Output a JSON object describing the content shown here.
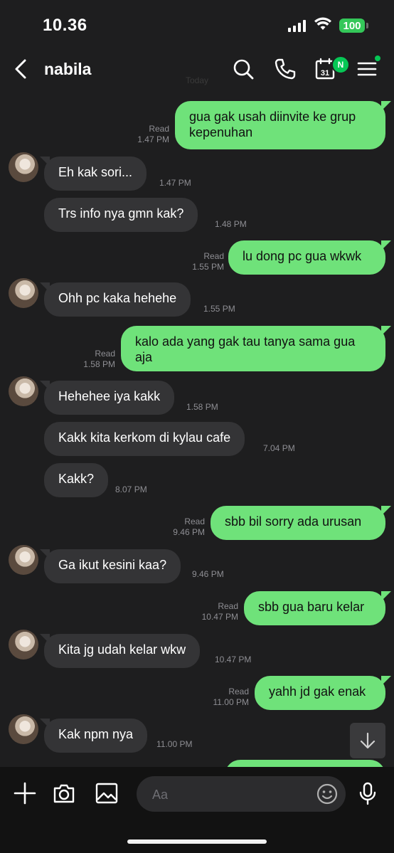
{
  "status_bar": {
    "time": "10.36",
    "battery": "100"
  },
  "header": {
    "title": "nabila",
    "calendar_day": "31",
    "badge": "N"
  },
  "divider_label": "Today",
  "messages": [
    {
      "dir": "out",
      "lines": [
        "gua gak usah diinvite ke grup",
        "kepenuhan"
      ],
      "read": "Read",
      "time": "1.47 PM"
    },
    {
      "dir": "in",
      "lines": [
        "Eh kak sori..."
      ],
      "time": "1.47 PM"
    },
    {
      "dir": "in",
      "lines": [
        "Trs info nya gmn kak?"
      ],
      "time": "1.48 PM"
    },
    {
      "dir": "out",
      "lines": [
        "lu dong pc gua wkwk"
      ],
      "read": "Read",
      "time": "1.55 PM"
    },
    {
      "dir": "in",
      "lines": [
        "Ohh pc kaka hehehe"
      ],
      "time": "1.55 PM"
    },
    {
      "dir": "out",
      "lines": [
        "kalo ada yang gak tau tanya sama gua",
        "aja"
      ],
      "read": "Read",
      "time": "1.58 PM"
    },
    {
      "dir": "in",
      "lines": [
        "Hehehee iya kakk"
      ],
      "time": "1.58 PM"
    },
    {
      "dir": "in",
      "lines": [
        "Kakk kita kerkom di kylau cafe"
      ],
      "time": "7.04 PM"
    },
    {
      "dir": "in",
      "lines": [
        "Kakk?"
      ],
      "time": "8.07 PM"
    },
    {
      "dir": "out",
      "lines": [
        "sbb bil sorry ada urusan"
      ],
      "read": "Read",
      "time": "9.46 PM"
    },
    {
      "dir": "in",
      "lines": [
        "Ga ikut kesini kaa?"
      ],
      "time": "9.46 PM"
    },
    {
      "dir": "out",
      "lines": [
        "sbb gua baru kelar"
      ],
      "read": "Read",
      "time": "10.47 PM"
    },
    {
      "dir": "in",
      "lines": [
        "Kita jg udah kelar wkw"
      ],
      "time": "10.47 PM"
    },
    {
      "dir": "out",
      "lines": [
        "yahh jd gak enak"
      ],
      "read": "Read",
      "time": "11.00 PM"
    },
    {
      "dir": "in",
      "lines": [
        "Kak npm nya"
      ],
      "time": "11.00 PM"
    }
  ],
  "composer": {
    "placeholder": "Aa"
  },
  "colors": {
    "outgoing": "#6fe27a",
    "incoming": "#343436",
    "background": "#1e1e1f",
    "accent": "#06c755"
  },
  "icons": [
    "back-icon",
    "search-icon",
    "phone-icon",
    "calendar-icon",
    "menu-icon",
    "plus-icon",
    "camera-icon",
    "image-icon",
    "emoji-icon",
    "mic-icon",
    "arrow-down-icon"
  ]
}
